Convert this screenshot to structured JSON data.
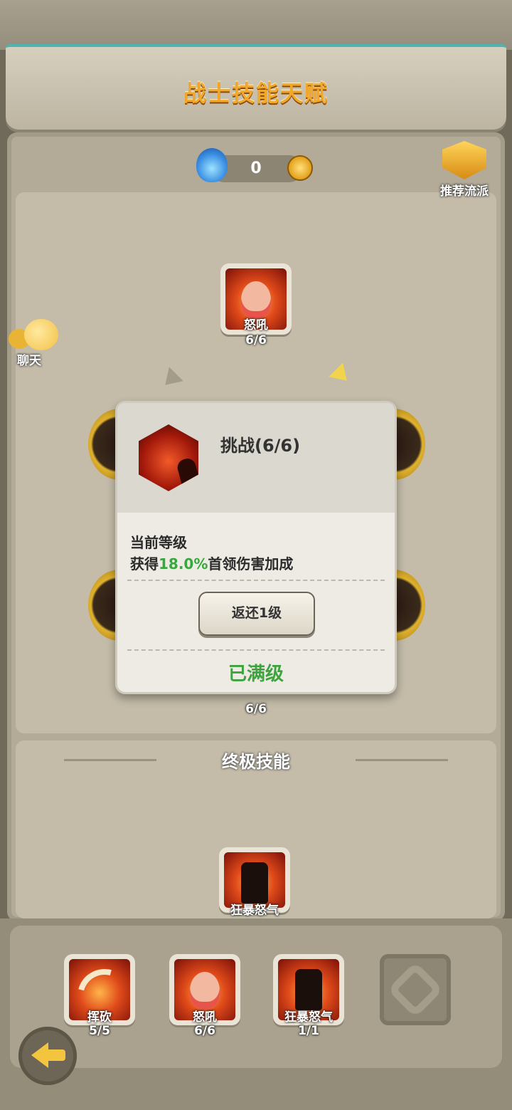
{
  "header": {
    "title": "战士技能天赋"
  },
  "currency": {
    "amount": "0"
  },
  "recommend": {
    "label": "推荐流派"
  },
  "chat": {
    "label": "聊天"
  },
  "tree": {
    "top_skill": {
      "name": "怒吼",
      "level": "6/6"
    },
    "hidden_skill_level": "6/6"
  },
  "modal": {
    "title": "挑战(6/6)",
    "current_level_label": "当前等级",
    "desc_prefix": "获得",
    "desc_value": "18.0%",
    "desc_suffix": "首领伤害加成",
    "return_button": "返还1级",
    "status": "已满级"
  },
  "ultimate": {
    "header": "终极技能",
    "skill": {
      "name": "狂暴怒气"
    }
  },
  "loadout": [
    {
      "name": "挥砍",
      "level": "5/5",
      "icon": "axe-swing-icon"
    },
    {
      "name": "怒吼",
      "level": "6/6",
      "icon": "roar-face-icon"
    },
    {
      "name": "狂暴怒气",
      "level": "1/1",
      "icon": "rage-flame-icon"
    }
  ],
  "colors": {
    "title": "#f2a82a",
    "highlight": "#37a83b",
    "maxed": "#3ca33e"
  }
}
